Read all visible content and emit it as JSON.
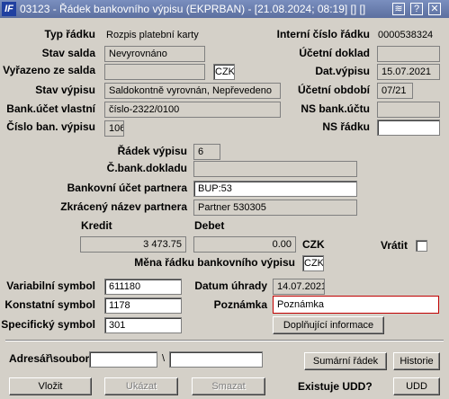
{
  "window": {
    "title": "03123 - Řádek bankovního výpisu (EKPRBAN) - [21.08.2024; 08:19] [] []",
    "app_icon": "IF",
    "title_buttons": [
      "≋",
      "?",
      "✕"
    ]
  },
  "left": {
    "typ_radku_label": "Typ řádku",
    "typ_radku_value": "Rozpis platební karty",
    "stav_salda_label": "Stav salda",
    "stav_salda_value": "Nevyrovnáno",
    "vyrazeno_label": "Vyřazeno ze salda",
    "vyrazeno_value": "",
    "mena_small": "CZK",
    "stav_vypisu_label": "Stav výpisu",
    "stav_vypisu_value": "Saldokontně vyrovnán, Nepřevedeno",
    "bank_ucet_label": "Bank.účet vlastní",
    "bank_ucet_value": "číslo-2322/0100",
    "cislo_vypisu_label": "Číslo ban. výpisu",
    "cislo_vypisu_value": "106"
  },
  "right": {
    "interni_cislo_label": "Interní číslo řádku",
    "interni_cislo_value": "0000538324",
    "ucetni_doklad_label": "Účetní doklad",
    "ucetni_doklad_value": "",
    "dat_vypisu_label": "Dat.výpisu",
    "dat_vypisu_value": "15.07.2021",
    "ucetni_obdobi_label": "Účetní období",
    "ucetni_obdobi_value": "07/21",
    "ns_bank_label": "NS bank.účtu",
    "ns_bank_value": "",
    "ns_radku_label": "NS řádku",
    "ns_radku_value": ""
  },
  "middle": {
    "radek_vypisu_label": "Řádek výpisu",
    "radek_vypisu_value": "6",
    "c_bank_dokladu_label": "Č.bank.dokladu",
    "c_bank_dokladu_value": "",
    "bankovni_ucet_partnera_label": "Bankovní účet partnera",
    "bankovni_ucet_partnera_value": "BUP:53",
    "zkraceny_nazev_label": "Zkrácený název partnera",
    "zkraceny_nazev_value": "Partner 530305",
    "kredit_label": "Kredit",
    "kredit_value": "3 473.75",
    "debet_label": "Debet",
    "debet_value": "0.00",
    "mena_label": "CZK",
    "vratit_label": "Vrátit",
    "mena_radku_label": "Měna řádku bankovního výpisu",
    "mena_radku_value": "CZK"
  },
  "symbols": {
    "variabilni_label": "Variabilní symbol",
    "variabilni_value": "611180",
    "konstatni_label": "Konstatní symbol",
    "konstatni_value": "1178",
    "specificky_label": "Specifický symbol",
    "specificky_value": "301",
    "datum_uhrady_label": "Datum úhrady",
    "datum_uhrady_value": "14.07.2021",
    "poznamka_label": "Poznámka",
    "poznamka_value": "Poznámka",
    "doplnujici_button": "Doplňující informace"
  },
  "bottom": {
    "adresar_label": "Adresář\\soubor",
    "adresar_value": "",
    "backslash": "\\",
    "soubor_value": "",
    "sumarni_button": "Sumární řádek",
    "historie_button": "Historie",
    "vlozit_button": "Vložit",
    "ukazat_button": "Ukázat",
    "smazat_button": "Smazat",
    "existuje_udd_label": "Existuje UDD?",
    "udd_button": "UDD"
  }
}
